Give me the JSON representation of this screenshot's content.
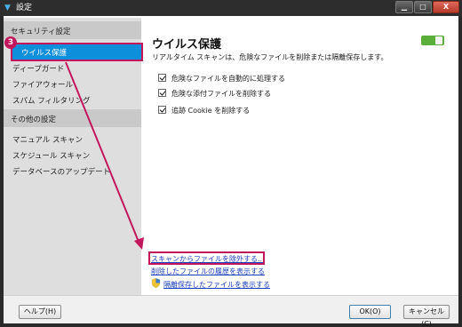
{
  "window": {
    "title": "設定",
    "app_icon": "▼",
    "controls": {
      "minimize": "▁",
      "maximize": "□",
      "close": "X"
    }
  },
  "callout": {
    "number": "3",
    "color": "#c2185b"
  },
  "sidebar": {
    "sections": [
      {
        "header": "セキュリティ設定",
        "items": [
          {
            "label": "ウイルス保護",
            "selected": true
          },
          {
            "label": "ディープガード",
            "selected": false
          },
          {
            "label": "ファイアウォール",
            "selected": false
          },
          {
            "label": "スパム フィルタリング",
            "selected": false
          }
        ]
      },
      {
        "header": "その他の設定",
        "items": [
          {
            "label": "マニュアル スキャン",
            "selected": false
          },
          {
            "label": "スケジュール スキャン",
            "selected": false
          },
          {
            "label": "データベースのアップデート",
            "selected": false
          }
        ]
      }
    ]
  },
  "main": {
    "title": "ウイルス保護",
    "description": "リアルタイム スキャンは、危険なファイルを削除または隔離保存します。",
    "toggle_on": true,
    "toggle_color": "#5aae3a",
    "options": [
      {
        "label": "危険なファイルを自動的に処理する",
        "checked": true
      },
      {
        "label": "危険な添付ファイルを削除する",
        "checked": true
      },
      {
        "label": "追跡 Cookie を削除する",
        "checked": true
      }
    ],
    "links": [
      {
        "label": "スキャンからファイルを除外する..."
      },
      {
        "label": "削除したファイルの履歴を表示する"
      },
      {
        "label": "隔離保存したファイルを表示する",
        "icon": "shield-icon"
      }
    ]
  },
  "footer": {
    "help": "ヘルプ(H)",
    "ok": "OK(O)",
    "cancel": "キャンセル(C)"
  }
}
